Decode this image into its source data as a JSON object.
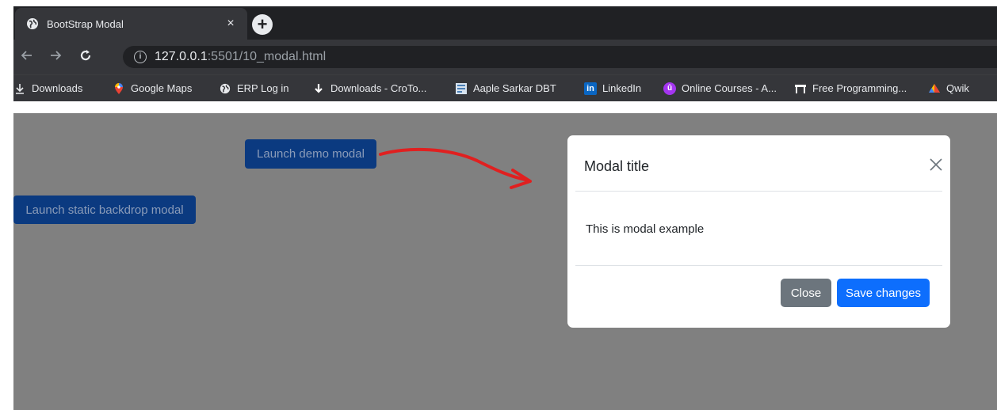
{
  "browser": {
    "tab_title": "BootStrap Modal",
    "tab_close": "×",
    "new_tab": "+",
    "url_host": "127.0.0.1",
    "url_rest": ":5501/10_modal.html",
    "icons": {
      "back": "back-arrow-icon",
      "forward": "forward-arrow-icon",
      "reload": "reload-icon",
      "info": "info-icon"
    }
  },
  "bookmarks": [
    {
      "label": "Downloads",
      "icon": "download-icon"
    },
    {
      "label": "Google Maps",
      "icon": "map-pin-icon"
    },
    {
      "label": "ERP Log in",
      "icon": "globe-icon"
    },
    {
      "label": "Downloads - CroTo...",
      "icon": "download-arrow-icon"
    },
    {
      "label": "Aaple Sarkar DBT",
      "icon": "document-icon"
    },
    {
      "label": "LinkedIn",
      "icon": "linkedin-icon"
    },
    {
      "label": "Online Courses - A...",
      "icon": "udemy-icon"
    },
    {
      "label": "Free Programming...",
      "icon": "bookmark-icon"
    },
    {
      "label": "Qwik",
      "icon": "cloud-icon"
    }
  ],
  "page": {
    "launch_demo_label": "Launch demo modal",
    "launch_static_label": "Launch static backdrop modal"
  },
  "modal": {
    "title": "Modal title",
    "body": "This is modal example",
    "close_label": "Close",
    "save_label": "Save changes"
  },
  "colors": {
    "backdrop": "#808080",
    "primary": "#0d6efd",
    "secondary": "#6c757d",
    "arrow": "#e02020"
  }
}
